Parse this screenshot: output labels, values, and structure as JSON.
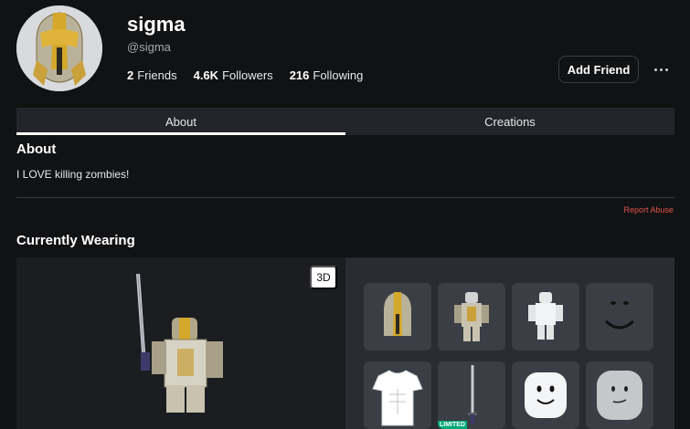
{
  "profile": {
    "display_name": "sigma",
    "handle": "@sigma",
    "stats": [
      {
        "count": "2",
        "label": "Friends"
      },
      {
        "count": "4.6K",
        "label": "Followers"
      },
      {
        "count": "216",
        "label": "Following"
      }
    ],
    "add_friend_label": "Add Friend"
  },
  "tabs": [
    {
      "label": "About",
      "active": true
    },
    {
      "label": "Creations",
      "active": false
    }
  ],
  "about": {
    "heading": "About",
    "text": "I LOVE killing zombies!",
    "report_label": "Report Abuse"
  },
  "wearing": {
    "heading": "Currently Wearing",
    "view_toggle_label": "3D",
    "items": [
      {
        "name": "helmet-item",
        "badge": ""
      },
      {
        "name": "armor-item",
        "badge": ""
      },
      {
        "name": "white-body-item",
        "badge": ""
      },
      {
        "name": "smile-face-item",
        "badge": ""
      },
      {
        "name": "shirt-item",
        "badge": ""
      },
      {
        "name": "sword-item",
        "badge": "LIMITED"
      },
      {
        "name": "white-head-item",
        "badge": ""
      },
      {
        "name": "grey-head-item",
        "badge": ""
      }
    ]
  },
  "colors": {
    "background": "#111214",
    "panel": "#23252a",
    "report": "#e0544a",
    "limited": "#00a876"
  }
}
